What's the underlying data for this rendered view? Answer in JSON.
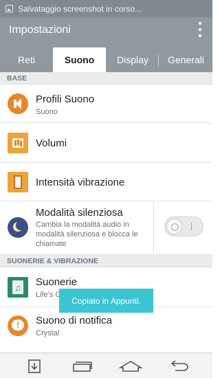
{
  "status_bar": {
    "text": "Salvataggio screenshot in corso..."
  },
  "action_bar": {
    "title": "Impostazioni"
  },
  "tabs": [
    {
      "label": "Reti"
    },
    {
      "label": "Suono"
    },
    {
      "label": "Display"
    },
    {
      "label": "Generali"
    }
  ],
  "sections": {
    "base": "BASE",
    "suonerie": "SUONERIE & VIBRAZIONE"
  },
  "rows": {
    "profili": {
      "title": "Profili Suono",
      "subtitle": "Suono"
    },
    "volumi": {
      "title": "Volumi"
    },
    "intensita": {
      "title": "Intensità vibrazione"
    },
    "modalita": {
      "title": "Modalità silenziosa",
      "subtitle": "Cambia la modalità audio in modalità silenziosa e blocca le chiamate",
      "toggle_on": false
    },
    "suonerie": {
      "title": "Suonerie",
      "subtitle": "Life's G"
    },
    "notifica": {
      "title": "Suono di notifica",
      "subtitle": "Crystal"
    }
  },
  "toast": {
    "text": "Copiato in Appunti."
  },
  "icons": {
    "profili": "speaker-icon",
    "volumi": "volume-icon",
    "intensita": "vibration-icon",
    "modalita": "moon-icon",
    "suonerie": "music-icon",
    "notifica": "notification-icon"
  },
  "colors": {
    "header": "#8f999f",
    "status": "#7f8a92",
    "accent_orange": "#e8862b",
    "toast": "#3bc4d1"
  }
}
